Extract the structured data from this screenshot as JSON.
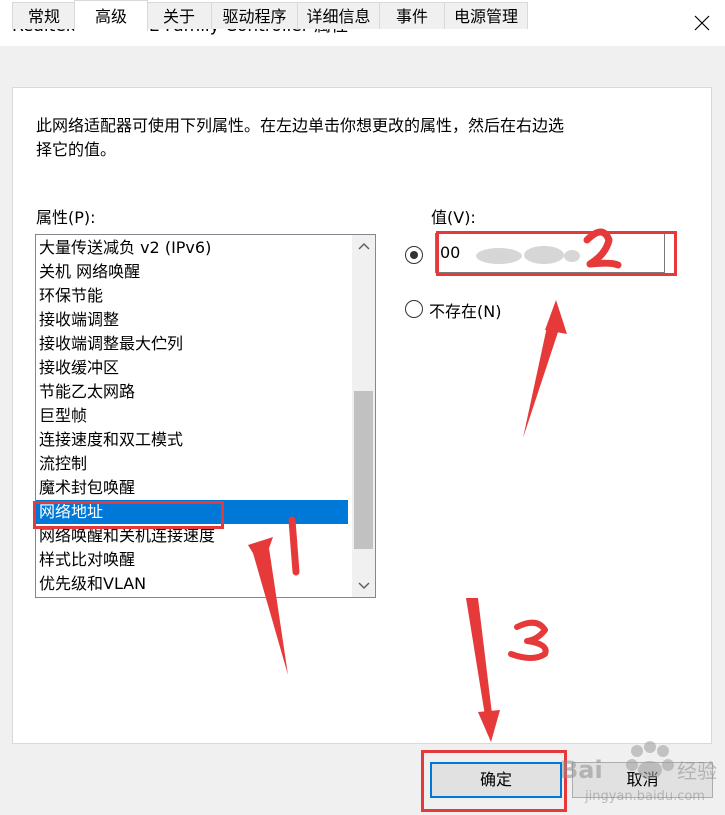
{
  "window": {
    "title": "Realtek PCIe GBE Family Controller 属性"
  },
  "tabs": [
    {
      "label": "常规",
      "active": false
    },
    {
      "label": "高级",
      "active": true
    },
    {
      "label": "关于",
      "active": false
    },
    {
      "label": "驱动程序",
      "active": false
    },
    {
      "label": "详细信息",
      "active": false
    },
    {
      "label": "事件",
      "active": false
    },
    {
      "label": "电源管理",
      "active": false
    }
  ],
  "advanced": {
    "description": "此网络适配器可使用下列属性。在左边单击你想更改的属性，然后在右边选择它的值。",
    "description_line1": "此网络适配器可使用下列属性。在左边单击你想更改的属性，然后在右边选",
    "description_line2": "择它的值。",
    "property_label": "属性(P):",
    "value_label": "值(V):",
    "properties": [
      "大量传送减负 v2 (IPv6)",
      "关机 网络唤醒",
      "环保节能",
      "接收端调整",
      "接收端调整最大伫列",
      "接收缓冲区",
      "节能乙太网路",
      "巨型帧",
      "连接速度和双工模式",
      "流控制",
      "魔术封包唤醒",
      "网络地址",
      "网络唤醒和关机连接速度",
      "样式比对唤醒",
      "优先级和VLAN"
    ],
    "selected_property": "网络地址",
    "value_option_selected": true,
    "value_text": "00",
    "not_present_label": "不存在(N)"
  },
  "buttons": {
    "ok_label": "确定",
    "cancel_label": "取消"
  },
  "annotations": {
    "step1": "1",
    "step2": "2",
    "step3": "3",
    "color": "#e6393a"
  },
  "watermark": {
    "brand": "Baidu经验",
    "url": "jingyan.baidu.com"
  }
}
